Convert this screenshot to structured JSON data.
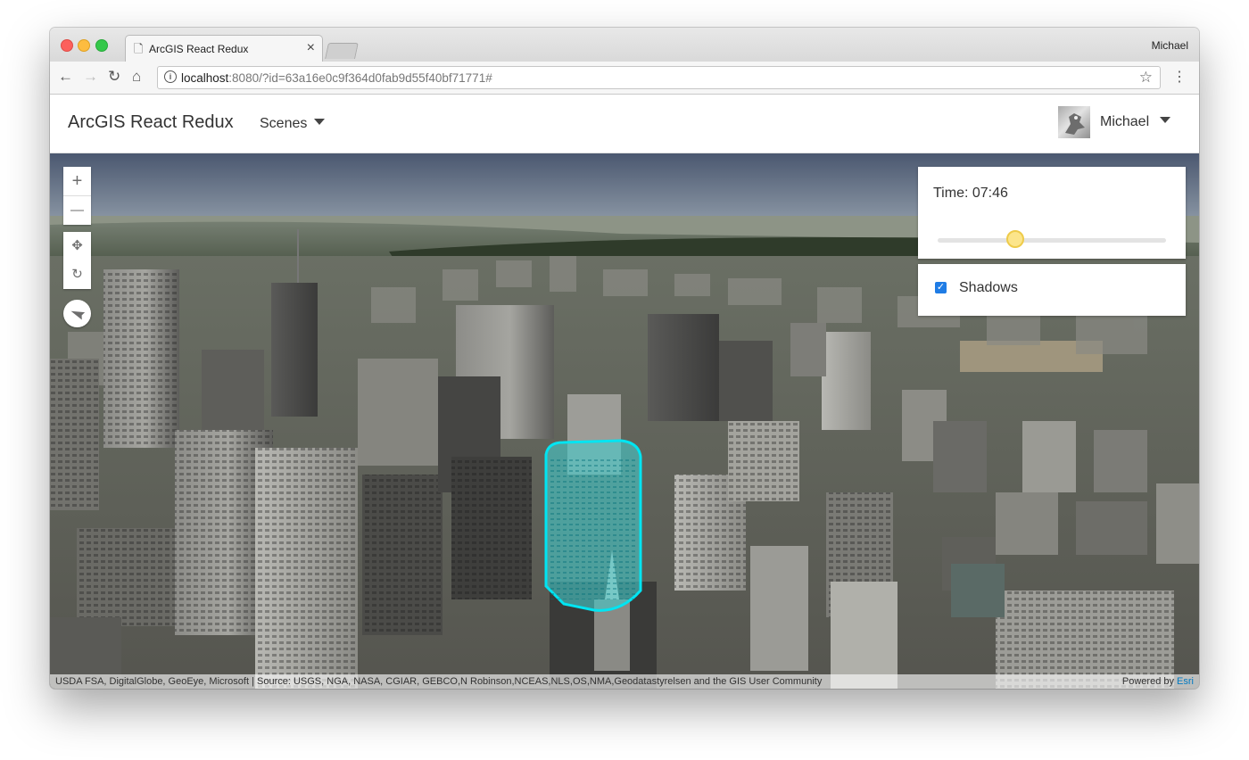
{
  "browser": {
    "tab_title": "ArcGIS React Redux",
    "tab_close": "×",
    "profile_name": "Michael",
    "url_host": "localhost",
    "url_rest": ":8080/?id=63a16e0c9f364d0fab9d55f40bf71771#",
    "nav": {
      "back": "←",
      "forward": "→",
      "reload": "↻",
      "home": "⌂"
    },
    "bookmark_icon": "☆",
    "menu_icon": "⋮",
    "info_icon": "i"
  },
  "header": {
    "app_title": "ArcGIS React Redux",
    "scenes_label": "Scenes",
    "user_name": "Michael"
  },
  "map_controls": {
    "zoom_in": "+",
    "zoom_out": "—",
    "pan": "✥",
    "rotate": "↻"
  },
  "time_panel": {
    "label": "Time: 07:46",
    "slider_fraction": 0.34,
    "thumb_color": "#fce58b"
  },
  "shadows_panel": {
    "checked": true,
    "check_glyph": "✓",
    "label": "Shadows"
  },
  "attribution": {
    "sources": "USDA FSA, DigitalGlobe, GeoEye, Microsoft | Source: USGS, NGA, NASA, CGIAR, GEBCO,N Robinson,NCEAS,NLS,OS,NMA,Geodatastyrelsen and the GIS User Community",
    "powered_by": "Powered by",
    "esri": "Esri"
  },
  "colors": {
    "highlight": "#00e5f2",
    "accent_check": "#1f7ce5",
    "esri_link": "#0079c1"
  }
}
